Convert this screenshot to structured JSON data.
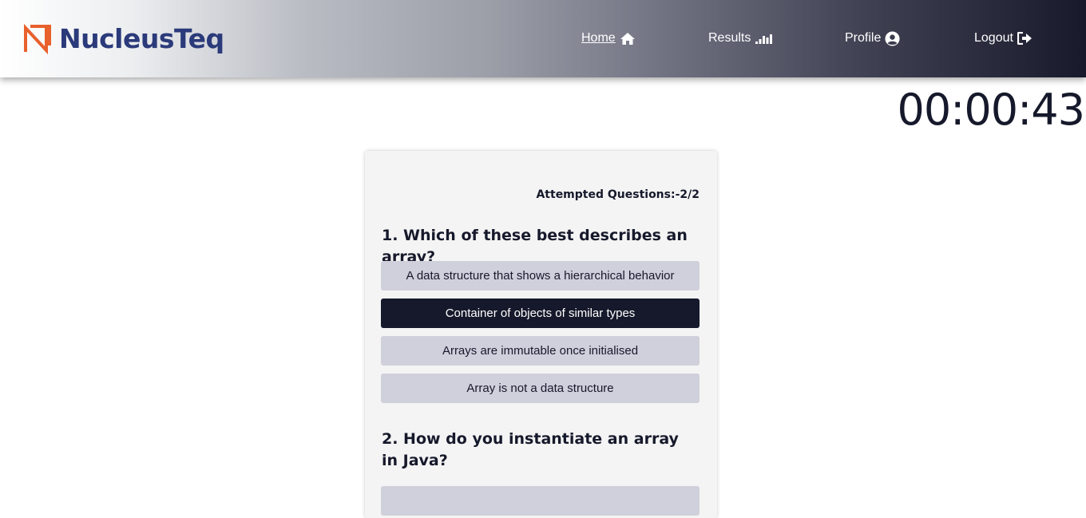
{
  "brand": {
    "name": "NucleusTeq",
    "logo_color": "#2b3a7a",
    "mark_color": "#e8602c"
  },
  "nav": [
    {
      "label": "Home",
      "icon": "home-icon",
      "active": true
    },
    {
      "label": "Results",
      "icon": "chart-bars-icon",
      "active": false
    },
    {
      "label": "Profile",
      "icon": "user-circle-icon",
      "active": false
    },
    {
      "label": "Logout",
      "icon": "sign-out-icon",
      "active": false
    }
  ],
  "timer": "00:00:43",
  "quiz": {
    "attempted": "Attempted Questions:-2/2",
    "questions": [
      {
        "text": "1. Which of these best describes an array?",
        "options": [
          "A data structure that shows a hierarchical behavior",
          "Container of objects of similar types",
          "Arrays are immutable once initialised",
          "Array is not a data structure"
        ],
        "selected_index": 1
      },
      {
        "text": "2. How do you instantiate an array in Java?",
        "options": []
      }
    ]
  },
  "colors": {
    "selected": "#16192b",
    "option": "#d0d0dc",
    "card": "#f4f4f4"
  }
}
